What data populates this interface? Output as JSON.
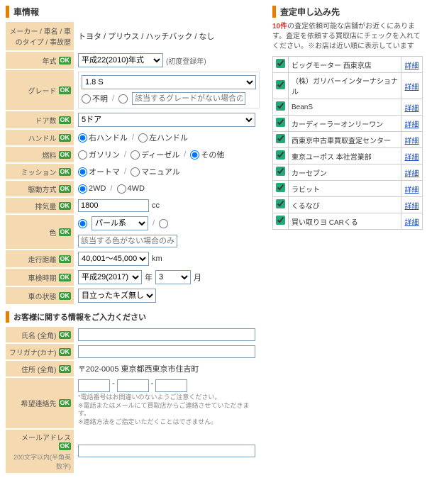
{
  "left": {
    "section_title": "車情報",
    "rows": {
      "maker": {
        "label": "メーカー / 車名 /\n車のタイプ / 事故歴",
        "value": "トヨタ / プリウス / ハッチバック / なし"
      },
      "year": {
        "label": "年式",
        "select": "平成22(2010)年式",
        "note": "(初度登録年)"
      },
      "grade": {
        "label": "グレード",
        "select": "1.8 S",
        "opt_unknown": "不明",
        "opt_input_ph": "該当するグレードがない場合のみ入力"
      },
      "doors": {
        "label": "ドア数",
        "select": "5ドア"
      },
      "handle": {
        "label": "ハンドル",
        "opt1": "右ハンドル",
        "opt2": "左ハンドル"
      },
      "fuel": {
        "label": "燃料",
        "opt1": "ガソリン",
        "opt2": "ディーゼル",
        "opt3": "その他"
      },
      "mission": {
        "label": "ミッション",
        "opt1": "オートマ",
        "opt2": "マニュアル"
      },
      "drive": {
        "label": "駆動方式",
        "opt1": "2WD",
        "opt2": "4WD"
      },
      "disp": {
        "label": "排気量",
        "value": "1800",
        "unit": "cc"
      },
      "color": {
        "label": "色",
        "select": "パール系",
        "opt_input_ph": "該当する色がない場合のみ入力"
      },
      "mileage": {
        "label": "走行距離",
        "select": "40,001～45,000",
        "unit": "km"
      },
      "shaken": {
        "label": "車検時期",
        "year": "平成29(2017)",
        "y_unit": "年",
        "month": "3",
        "m_unit": "月"
      },
      "condition": {
        "label": "車の状態",
        "select": "目立ったキズ無し"
      }
    },
    "customer_title": "お客様に関する情報をご入力ください",
    "customer": {
      "name": {
        "label": "氏名 (全角)"
      },
      "kana": {
        "label": "フリガナ(カナ)"
      },
      "addr": {
        "label": "住所 (全角)",
        "value": "〒202-0005 東京都西東京市住吉町"
      },
      "tel": {
        "label": "希望連絡先",
        "note": "*電話番号はお間違いのないようご注意ください。\n※電話またはメールにて買取店からご連絡させていただきます。\n※連絡方法をご指定いただくことはできません。"
      },
      "mail": {
        "label": "メールアドレス",
        "sublabel": "200文字以内(半角英数字)"
      }
    },
    "ok": "OK"
  },
  "right": {
    "title": "査定申し込み先",
    "desc_count": "10件",
    "desc": "の査定依頼可能な店舗がお近くにあります。査定を依頼する買取店にチェックを入れてください。※お店は近い順に表示しています",
    "detail": "詳細",
    "shops": [
      "ビッグモーター  西東京店",
      "（株）ガリバーインターナショナル",
      "BeanS",
      "カーディーラーオンリーワン",
      "西東京中古車買取査定センター",
      "東京ユーポス 本社営業部",
      "カーセブン",
      "ラビット",
      "くるなび",
      "買い取りヨ CARくる"
    ]
  }
}
